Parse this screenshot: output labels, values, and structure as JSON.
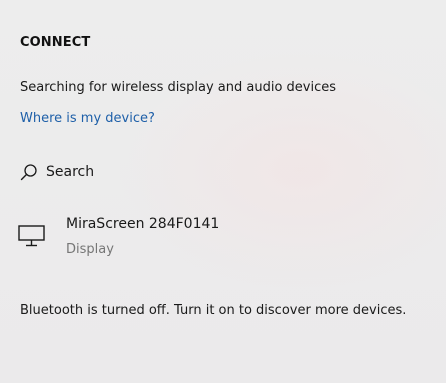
{
  "panel": {
    "title": "CONNECT",
    "status": "Searching for wireless display and audio devices",
    "help_link": "Where is my device?",
    "search": {
      "icon": "search-icon",
      "label": "Search"
    },
    "devices": [
      {
        "icon": "monitor-icon",
        "name": "MiraScreen 284F0141",
        "type": "Display"
      }
    ],
    "bluetooth_message": "Bluetooth is turned off. Turn it on to discover more devices."
  },
  "colors": {
    "background": "#ecebec",
    "link": "#1d5fa8",
    "secondary_text": "#767676",
    "primary_text": "#1a1a1a"
  }
}
